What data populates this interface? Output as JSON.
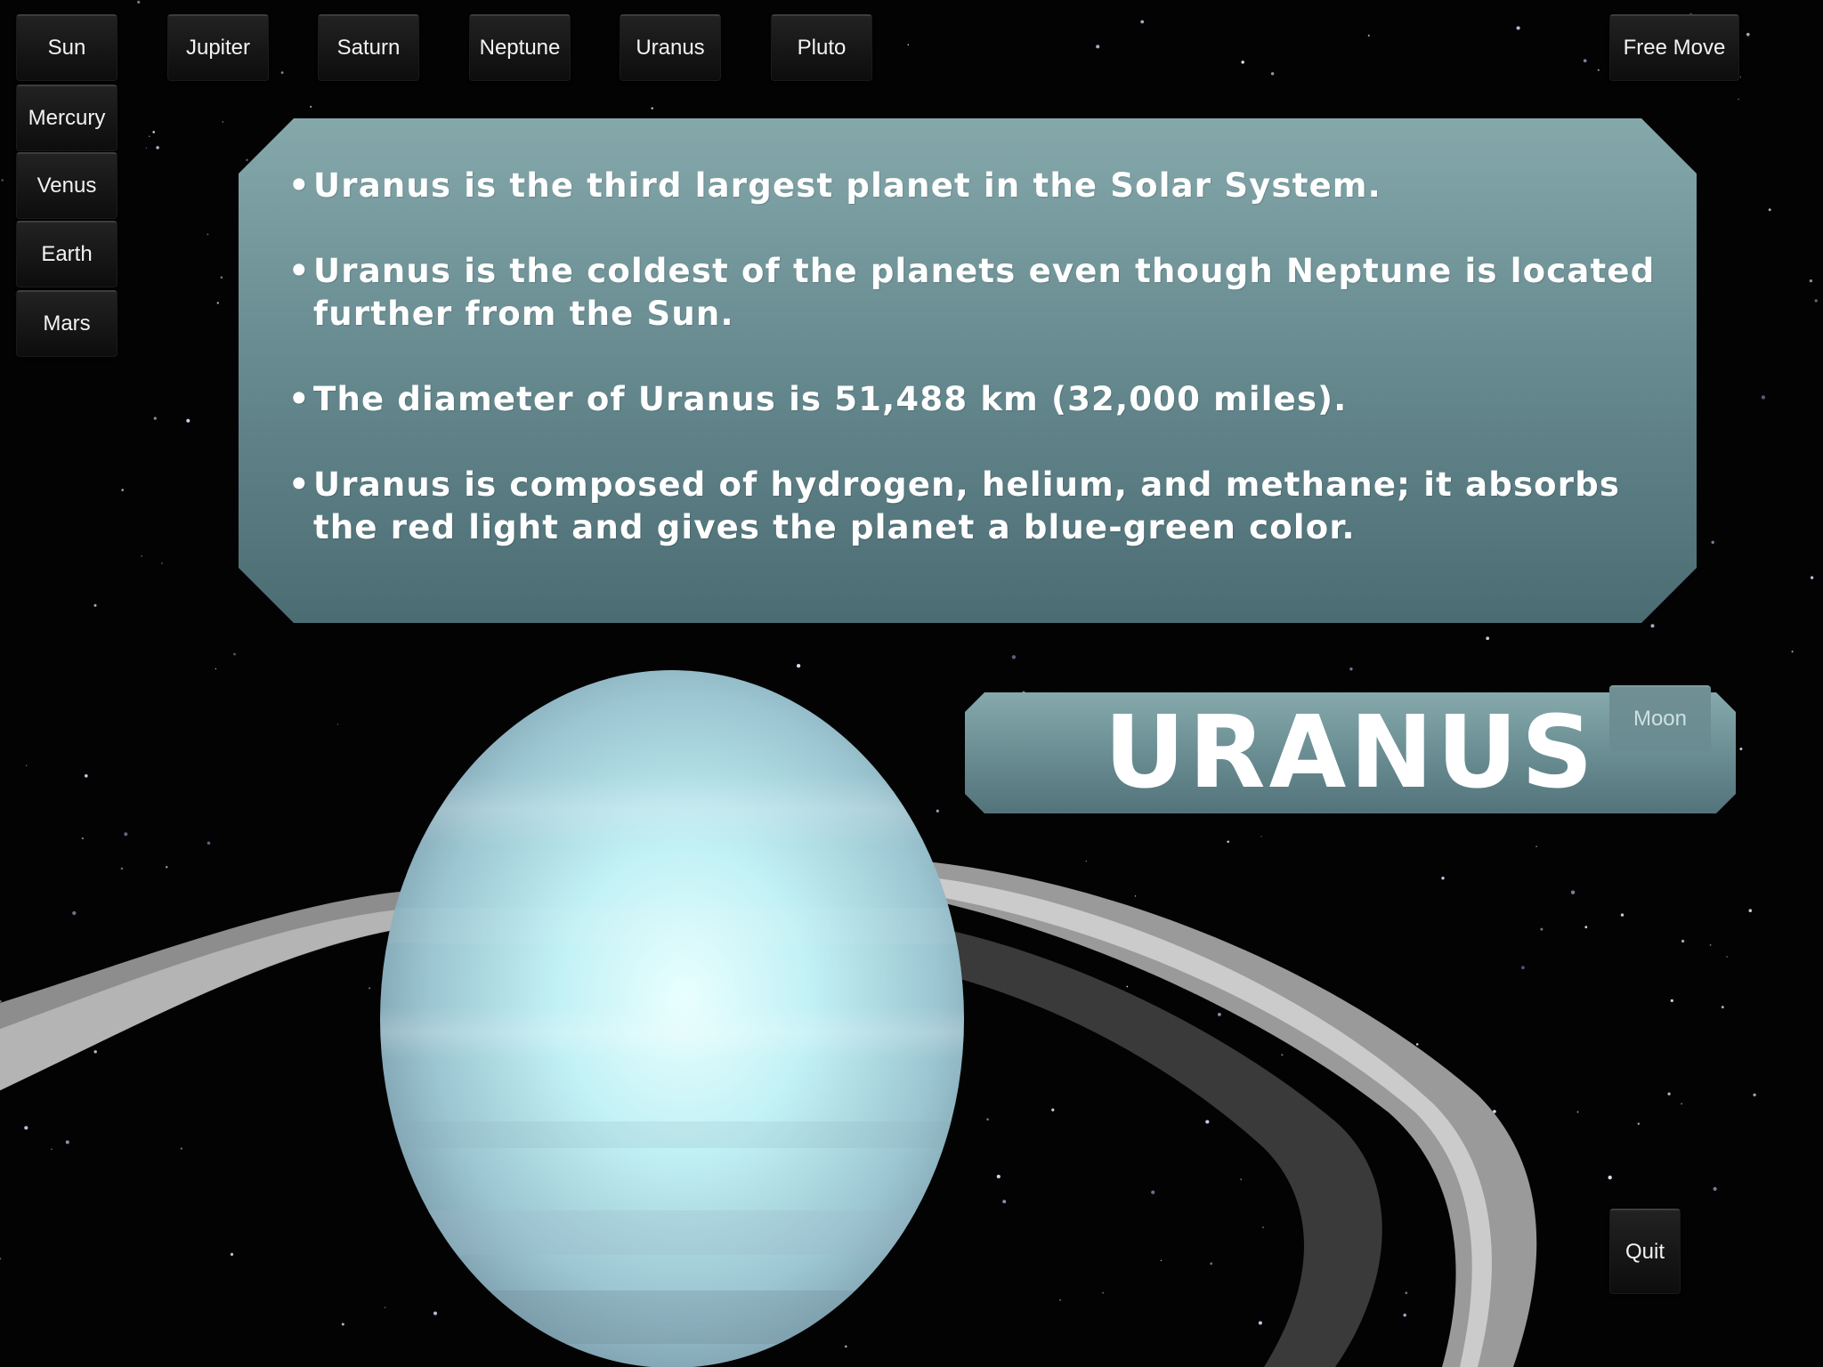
{
  "nav": {
    "top": [
      {
        "label": "Sun"
      },
      {
        "label": "Jupiter"
      },
      {
        "label": "Saturn"
      },
      {
        "label": "Neptune"
      },
      {
        "label": "Uranus"
      },
      {
        "label": "Pluto"
      }
    ],
    "side": [
      {
        "label": "Mercury"
      },
      {
        "label": "Venus"
      },
      {
        "label": "Earth"
      },
      {
        "label": "Mars"
      }
    ],
    "free_move_label": "Free Move",
    "moon_label": "Moon",
    "quit_label": "Quit"
  },
  "info": {
    "facts": [
      "Uranus is the third largest planet in the Solar System.",
      "Uranus is the coldest of the planets even though Neptune is located further from the Sun.",
      "The diameter of Uranus is 51,488 km (32,000 miles).",
      "Uranus is composed of hydrogen, helium, and methane; it absorbs the red light and gives the planet a blue-green color."
    ]
  },
  "planet": {
    "title": "URANUS"
  },
  "colors": {
    "panel": "#6a8e93",
    "planet": "#bfeff2",
    "space": "#030304"
  }
}
